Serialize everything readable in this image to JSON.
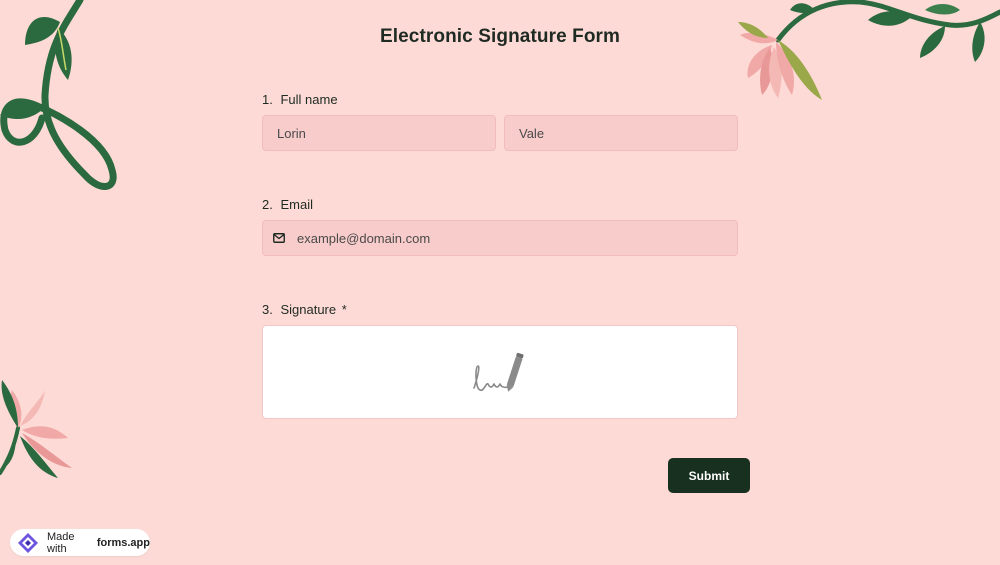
{
  "form": {
    "title": "Electronic Signature Form"
  },
  "questions": [
    {
      "number": "1.",
      "label": "Full name",
      "required": false
    },
    {
      "number": "2.",
      "label": "Email",
      "required": false
    },
    {
      "number": "3.",
      "label": "Signature",
      "required": true,
      "required_mark": "*"
    }
  ],
  "full_name": {
    "first_value": "Lorin",
    "last_value": "Vale"
  },
  "email": {
    "placeholder": "example@domain.com",
    "icon": "envelope-icon"
  },
  "signature": {
    "icon": "signature-pen-icon"
  },
  "submit": {
    "label": "Submit"
  },
  "badge": {
    "prefix": "Made with",
    "brand": "forms.app",
    "icon": "forms-app-logo-icon"
  },
  "colors": {
    "background": "#fddad6",
    "input_fill": "#f8cccb",
    "submit_bg": "#17301f",
    "leaf_green": "#2b6a3e",
    "flower_pink": "#f0a9a6"
  }
}
